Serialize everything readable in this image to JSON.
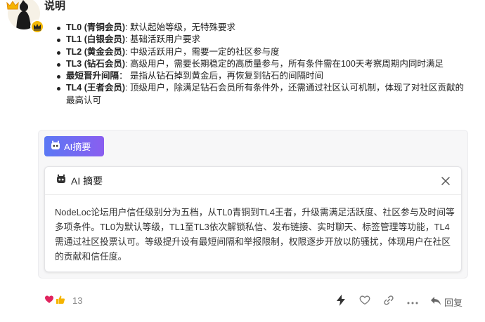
{
  "post": {
    "title": "说明",
    "levels": [
      {
        "name": "TL0 (青铜会员)",
        "desc": ": 默认起始等级，无特殊要求"
      },
      {
        "name": "TL1 (白银会员)",
        "desc": ": 基础活跃用户要求"
      },
      {
        "name": "TL2 (黄金会员)",
        "desc": ": 中级活跃用户，需要一定的社区参与度"
      },
      {
        "name": "TL3 (钻石会员)",
        "desc": ": 高级用户，需要长期稳定的高质量参与，所有条件需在100天考察周期内同时满足"
      },
      {
        "name": "最短晋升间隔",
        "desc": "： 是指从钻石掉到黄金后，再恢复到钻石的间隔时间"
      },
      {
        "name": "TL4 (王者会员)",
        "desc": ": 顶级用户，除满足钻石会员所有条件外，还需通过社区认可机制，体现了对社区贡献的最高认可"
      }
    ]
  },
  "ai": {
    "button_label": "AI摘要",
    "panel_title": "AI 摘要",
    "summary": "NodeLoc论坛用户信任级别分为五档，从TL0青铜到TL4王者，升级需满足活跃度、社区参与及时间等多项条件。TL0为默认等级，TL1至TL3依次解锁私信、发布链接、实时聊天、标签管理等功能，TL4需通过社区投票认可。等级提升设有最短间隔和举报限制，权限逐步开放以防骚扰，体现用户在社区的贡献和信任度。"
  },
  "footer": {
    "reaction_count": "13",
    "reply_label": "回复"
  },
  "colors": {
    "ai_gradient_start": "#5b78f4",
    "ai_gradient_end": "#8a5ef0",
    "badge_gold": "#f2b705"
  }
}
